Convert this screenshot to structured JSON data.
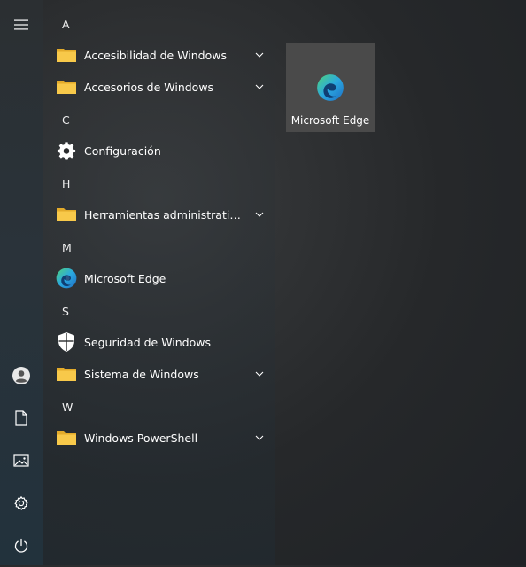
{
  "sidebar": {
    "items": [
      {
        "name": "menu",
        "icon": "hamburger-menu-icon"
      },
      {
        "name": "account",
        "icon": "user-account-icon"
      },
      {
        "name": "documents",
        "icon": "document-icon"
      },
      {
        "name": "pictures",
        "icon": "picture-icon"
      },
      {
        "name": "settings",
        "icon": "gear-icon"
      },
      {
        "name": "power",
        "icon": "power-icon"
      }
    ]
  },
  "app_list": {
    "groups": [
      {
        "letter": "A",
        "apps": [
          {
            "label": "Accesibilidad de Windows",
            "icon": "folder-icon",
            "expandable": true
          },
          {
            "label": "Accesorios de Windows",
            "icon": "folder-icon",
            "expandable": true
          }
        ]
      },
      {
        "letter": "C",
        "apps": [
          {
            "label": "Configuración",
            "icon": "gear-icon",
            "expandable": false
          }
        ]
      },
      {
        "letter": "H",
        "apps": [
          {
            "label": "Herramientas administrativas de...",
            "icon": "folder-icon",
            "expandable": true
          }
        ]
      },
      {
        "letter": "M",
        "apps": [
          {
            "label": "Microsoft Edge",
            "icon": "edge-icon",
            "expandable": false
          }
        ]
      },
      {
        "letter": "S",
        "apps": [
          {
            "label": "Seguridad de Windows",
            "icon": "shield-icon",
            "expandable": false
          },
          {
            "label": "Sistema de Windows",
            "icon": "folder-icon",
            "expandable": true
          }
        ]
      },
      {
        "letter": "W",
        "apps": [
          {
            "label": "Windows PowerShell",
            "icon": "folder-icon",
            "expandable": true
          }
        ]
      }
    ]
  },
  "tiles": [
    {
      "label": "Microsoft Edge",
      "icon": "edge-icon"
    }
  ],
  "colors": {
    "folder": "#f8c94a",
    "folder_dark": "#e3ab2b",
    "tile_bg": "#4a4a4a",
    "edge_blue": "#1f6fc4",
    "edge_green": "#4fd27a"
  }
}
